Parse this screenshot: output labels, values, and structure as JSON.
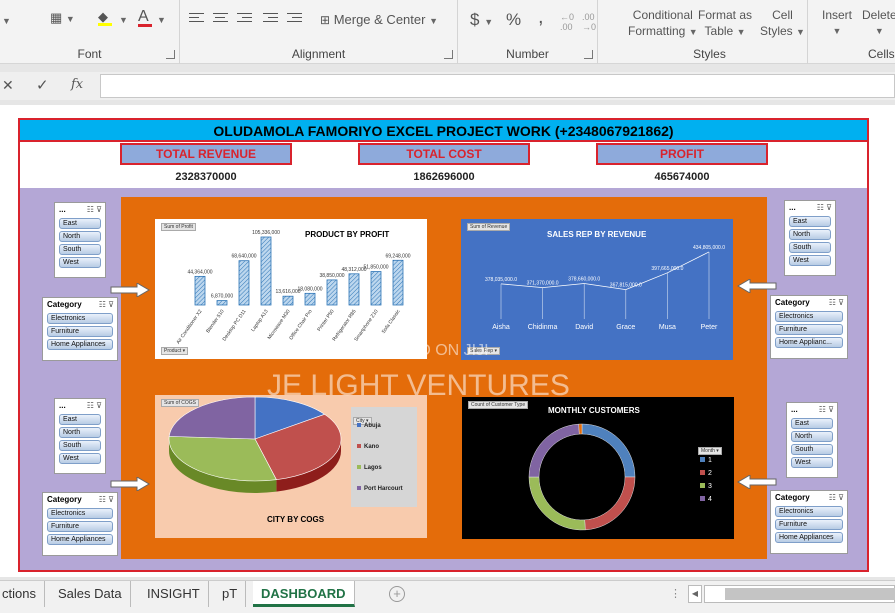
{
  "ribbon": {
    "groups": {
      "font": "Font",
      "alignment": "Alignment",
      "number": "Number",
      "styles": "Styles",
      "cells": "Cells"
    },
    "merge_center": "Merge & Center",
    "currency": "$",
    "percent": "%",
    "comma": ",",
    "font_color_letter": "A",
    "conditional_formatting": [
      "Conditional",
      "Formatting"
    ],
    "format_as_table": [
      "Format as",
      "Table"
    ],
    "cell_styles": [
      "Cell",
      "Styles"
    ],
    "insert": "Insert",
    "delete": "Delete"
  },
  "formula_bar": {
    "fx": "fx",
    "cancel": "✕",
    "enter": "✓"
  },
  "dashboard": {
    "title": "OLUDAMOLA FAMORIYO EXCEL PROJECT WORK (+2348067921862)",
    "kpis": [
      {
        "label": "TOTAL REVENUE",
        "value": "2328370000"
      },
      {
        "label": "TOTAL COST",
        "value": "1862696000"
      },
      {
        "label": "PROFIT",
        "value": "465674000"
      }
    ]
  },
  "chart_data": [
    {
      "type": "bar",
      "title": "PRODUCT BY PROFIT",
      "field_value": "Sum of Profit",
      "field_axis": "Product",
      "categories": [
        "Air Conditioner X2",
        "Blender 510",
        "Desktop PC D11",
        "Laptop A13",
        "Microwave M30",
        "Office Chair Pro",
        "Printer P50",
        "Refrigerator R85",
        "Smartphone Z10",
        "Sofa Classic"
      ],
      "values": [
        44364000,
        6870000,
        68640000,
        105336000,
        13616000,
        18080000,
        38850000,
        48312000,
        51850000,
        69248000
      ],
      "labels": [
        "44,364,000",
        "6,870,000",
        "68,640,000",
        "105,336,000",
        "13,616,000",
        "18,080,000",
        "38,850,000",
        "48,312,000",
        "51,850,000",
        "69,248,000"
      ],
      "colors": {
        "bar": "#9dc3e6",
        "stroke": "#2e75b6"
      }
    },
    {
      "type": "line",
      "title": "SALES REP BY REVENUE",
      "field_value": "Sum of Revenue",
      "field_axis": "Sales Rep",
      "categories": [
        "Aisha",
        "Chidinma",
        "David",
        "Grace",
        "Musa",
        "Peter"
      ],
      "values": [
        378035000,
        371370000,
        378660000,
        367815000,
        397665000,
        434805000
      ],
      "labels": [
        "378,035,000.0",
        "371,370,000.0",
        "378,660,000.0",
        "367,815,000.0",
        "397,665,000.0",
        "434,805,000.0"
      ],
      "colors": {
        "background": "#4472c4",
        "line": "#ffffff"
      }
    },
    {
      "type": "pie",
      "title": "CITY BY COGS",
      "field_value": "Sum of COGS",
      "field_legend": "City",
      "slices": [
        {
          "label": "Abuja",
          "value": 0.15,
          "color": "#4472c4"
        },
        {
          "label": "Kano",
          "value": 0.31,
          "color": "#c0504d"
        },
        {
          "label": "Lagos",
          "value": 0.3,
          "color": "#9bbb59"
        },
        {
          "label": "Port Harcourt",
          "value": 0.24,
          "color": "#8064a2"
        }
      ]
    },
    {
      "type": "pie",
      "title": "MONTHLY CUSTOMERS",
      "field_value": "Count of Customer Type",
      "field_legend": "Month",
      "slices": [
        {
          "label": "1",
          "value": 0.25,
          "color": "#4f81bd"
        },
        {
          "label": "2",
          "value": 0.24,
          "color": "#c0504d"
        },
        {
          "label": "3",
          "value": 0.26,
          "color": "#9bbb59"
        },
        {
          "label": "4",
          "value": 0.24,
          "color": "#8064a2"
        },
        {
          "label": "",
          "value": 0.01,
          "color": "#e46c0a"
        }
      ]
    }
  ],
  "slicers": {
    "region_header": "...",
    "region_items": [
      "East",
      "North",
      "South",
      "West"
    ],
    "category_header": "Category",
    "category_items": [
      "Electronics",
      "Furniture",
      "Home Appliances"
    ],
    "category_items_trunc": [
      "Electronics",
      "Furniture",
      "Home Applianc..."
    ]
  },
  "watermark": {
    "line1": "POSTED ON JIJI",
    "line2": "JE LIGHT VENTURES"
  },
  "tabs": [
    "ctions",
    "Sales Data",
    "INSIGHT",
    "pT",
    "DASHBOARD"
  ],
  "active_tab": "DASHBOARD"
}
